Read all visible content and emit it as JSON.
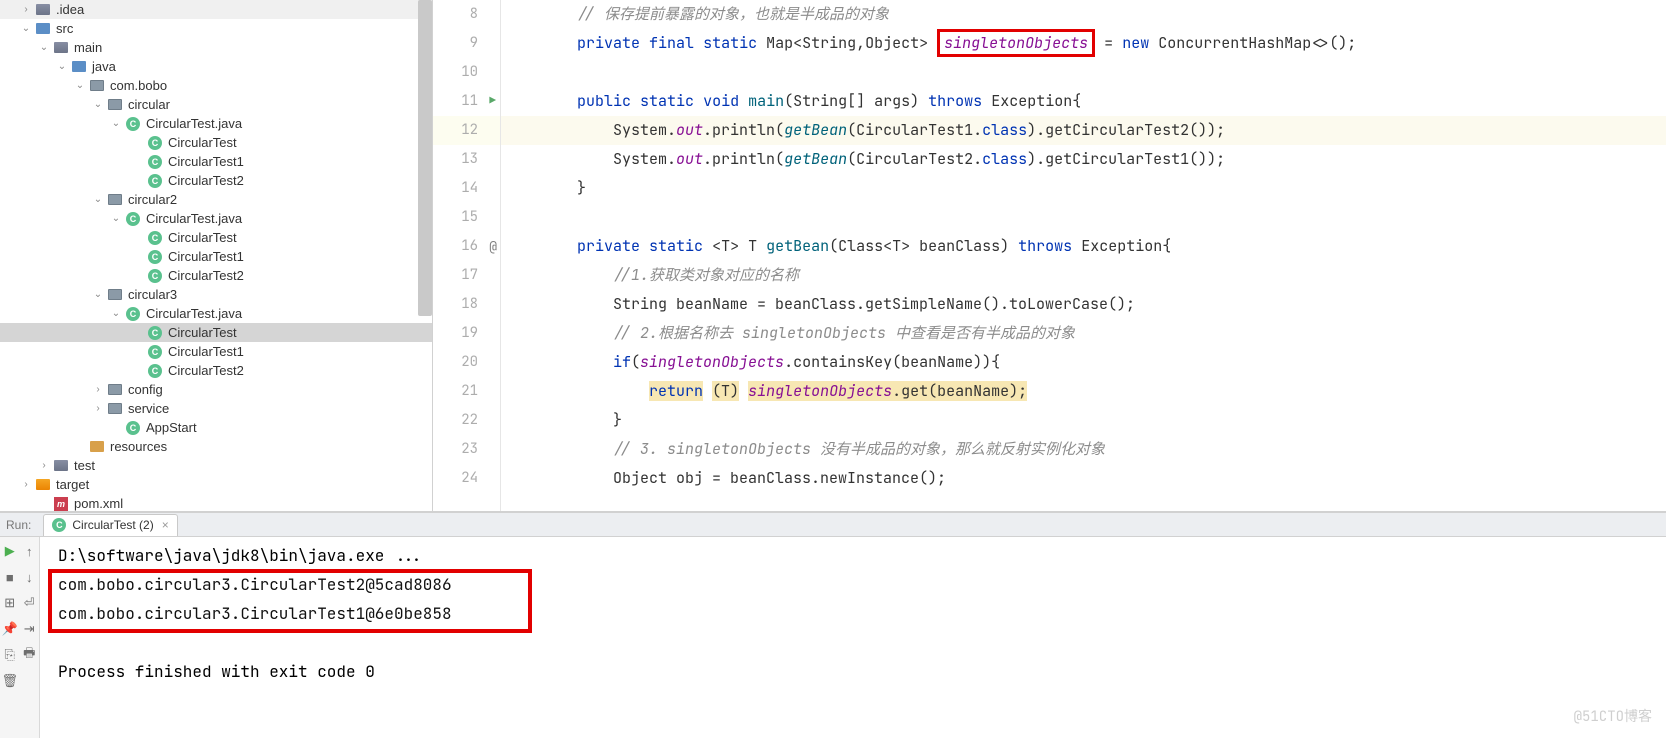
{
  "tree": [
    {
      "indent": 18,
      "chev": "›",
      "icon": "folder-src",
      "label": ".idea"
    },
    {
      "indent": 18,
      "chev": "⌄",
      "icon": "folder-java",
      "label": "src"
    },
    {
      "indent": 36,
      "chev": "⌄",
      "icon": "folder-src",
      "label": "main"
    },
    {
      "indent": 54,
      "chev": "⌄",
      "icon": "folder-java",
      "label": "java"
    },
    {
      "indent": 72,
      "chev": "⌄",
      "icon": "folder-pkg",
      "label": "com.bobo"
    },
    {
      "indent": 90,
      "chev": "⌄",
      "icon": "folder-pkg",
      "label": "circular"
    },
    {
      "indent": 108,
      "chev": "⌄",
      "icon": "class-icon",
      "label": "CircularTest.java"
    },
    {
      "indent": 130,
      "chev": "",
      "icon": "class-icon",
      "label": "CircularTest"
    },
    {
      "indent": 130,
      "chev": "",
      "icon": "class-icon",
      "label": "CircularTest1"
    },
    {
      "indent": 130,
      "chev": "",
      "icon": "class-icon",
      "label": "CircularTest2"
    },
    {
      "indent": 90,
      "chev": "⌄",
      "icon": "folder-pkg",
      "label": "circular2"
    },
    {
      "indent": 108,
      "chev": "⌄",
      "icon": "class-icon",
      "label": "CircularTest.java"
    },
    {
      "indent": 130,
      "chev": "",
      "icon": "class-icon",
      "label": "CircularTest"
    },
    {
      "indent": 130,
      "chev": "",
      "icon": "class-icon",
      "label": "CircularTest1"
    },
    {
      "indent": 130,
      "chev": "",
      "icon": "class-icon",
      "label": "CircularTest2"
    },
    {
      "indent": 90,
      "chev": "⌄",
      "icon": "folder-pkg",
      "label": "circular3"
    },
    {
      "indent": 108,
      "chev": "⌄",
      "icon": "class-icon",
      "label": "CircularTest.java"
    },
    {
      "indent": 130,
      "chev": "",
      "icon": "class-icon",
      "label": "CircularTest",
      "selected": true
    },
    {
      "indent": 130,
      "chev": "",
      "icon": "class-icon",
      "label": "CircularTest1"
    },
    {
      "indent": 130,
      "chev": "",
      "icon": "class-icon",
      "label": "CircularTest2"
    },
    {
      "indent": 90,
      "chev": "›",
      "icon": "folder-pkg",
      "label": "config"
    },
    {
      "indent": 90,
      "chev": "›",
      "icon": "folder-pkg",
      "label": "service"
    },
    {
      "indent": 108,
      "chev": "",
      "icon": "class-icon",
      "label": "AppStart"
    },
    {
      "indent": 72,
      "chev": "",
      "icon": "folder-res",
      "label": "resources"
    },
    {
      "indent": 36,
      "chev": "›",
      "icon": "folder-src",
      "label": "test"
    },
    {
      "indent": 18,
      "chev": "›",
      "icon": "folder-target",
      "label": "target"
    },
    {
      "indent": 36,
      "chev": "",
      "icon": "mvn-icon",
      "label": "pom.xml"
    }
  ],
  "gutter": [
    {
      "n": 8,
      "mark": ""
    },
    {
      "n": 9,
      "mark": ""
    },
    {
      "n": 10,
      "mark": ""
    },
    {
      "n": 11,
      "mark": "run"
    },
    {
      "n": 12,
      "mark": "",
      "current": true
    },
    {
      "n": 13,
      "mark": ""
    },
    {
      "n": 14,
      "mark": ""
    },
    {
      "n": 15,
      "mark": ""
    },
    {
      "n": 16,
      "mark": "annot"
    },
    {
      "n": 17,
      "mark": ""
    },
    {
      "n": 18,
      "mark": ""
    },
    {
      "n": 19,
      "mark": ""
    },
    {
      "n": 20,
      "mark": ""
    },
    {
      "n": 21,
      "mark": ""
    },
    {
      "n": 22,
      "mark": ""
    },
    {
      "n": 23,
      "mark": ""
    },
    {
      "n": 24,
      "mark": ""
    }
  ],
  "code": {
    "c8": "// 保存提前暴露的对象，也就是半成品的对象",
    "c9a": "private",
    "c9b": "final",
    "c9c": "static",
    "c9d": "Map<String,Object>",
    "c9e": "singletonObjects",
    "c9f": "=",
    "c9g": "new",
    "c9h": "ConcurrentHashMap<>();",
    "c11a": "public",
    "c11b": "static",
    "c11c": "void",
    "c11d": "main",
    "c11e": "(String[] args)",
    "c11f": "throws",
    "c11g": "Exception{",
    "c12a": "System.",
    "c12b": "out",
    "c12c": ".println(",
    "c12d": "getBean",
    "c12e": "(CircularTest1.",
    "c12f": "class",
    "c12g": ").getCircularTest2());",
    "c13a": "System.",
    "c13b": "out",
    "c13c": ".println(",
    "c13d": "getBean",
    "c13e": "(CircularTest2.",
    "c13f": "class",
    "c13g": ").getCircularTest1());",
    "c14": "}",
    "c16a": "private",
    "c16b": "static",
    "c16c": "<T> T",
    "c16d": "getBean",
    "c16e": "(Class<T> beanClass)",
    "c16f": "throws",
    "c16g": "Exception{",
    "c17": "//1.获取类对象对应的名称",
    "c18": "String beanName = beanClass.getSimpleName().toLowerCase();",
    "c19": "// 2.根据名称去 singletonObjects 中查看是否有半成品的对象",
    "c20a": "if",
    "c20b": "(",
    "c20c": "singletonObjects",
    "c20d": ".containsKey(beanName)){",
    "c21a": "return",
    "c21b": "(T)",
    "c21c": "singletonObjects",
    "c21d": ".get(beanName);",
    "c22": "}",
    "c23": "// 3. singletonObjects 没有半成品的对象，那么就反射实例化对象",
    "c24": "Object obj = beanClass.newInstance();"
  },
  "run": {
    "label": "Run:",
    "tab": "CircularTest (2)",
    "line1": "D:\\software\\java\\jdk8\\bin\\java.exe ...",
    "line2": "com.bobo.circular3.CircularTest2@5cad8086",
    "line3": "com.bobo.circular3.CircularTest1@6e0be858",
    "line4": "Process finished with exit code 0"
  },
  "watermark": "@51CTO博客"
}
